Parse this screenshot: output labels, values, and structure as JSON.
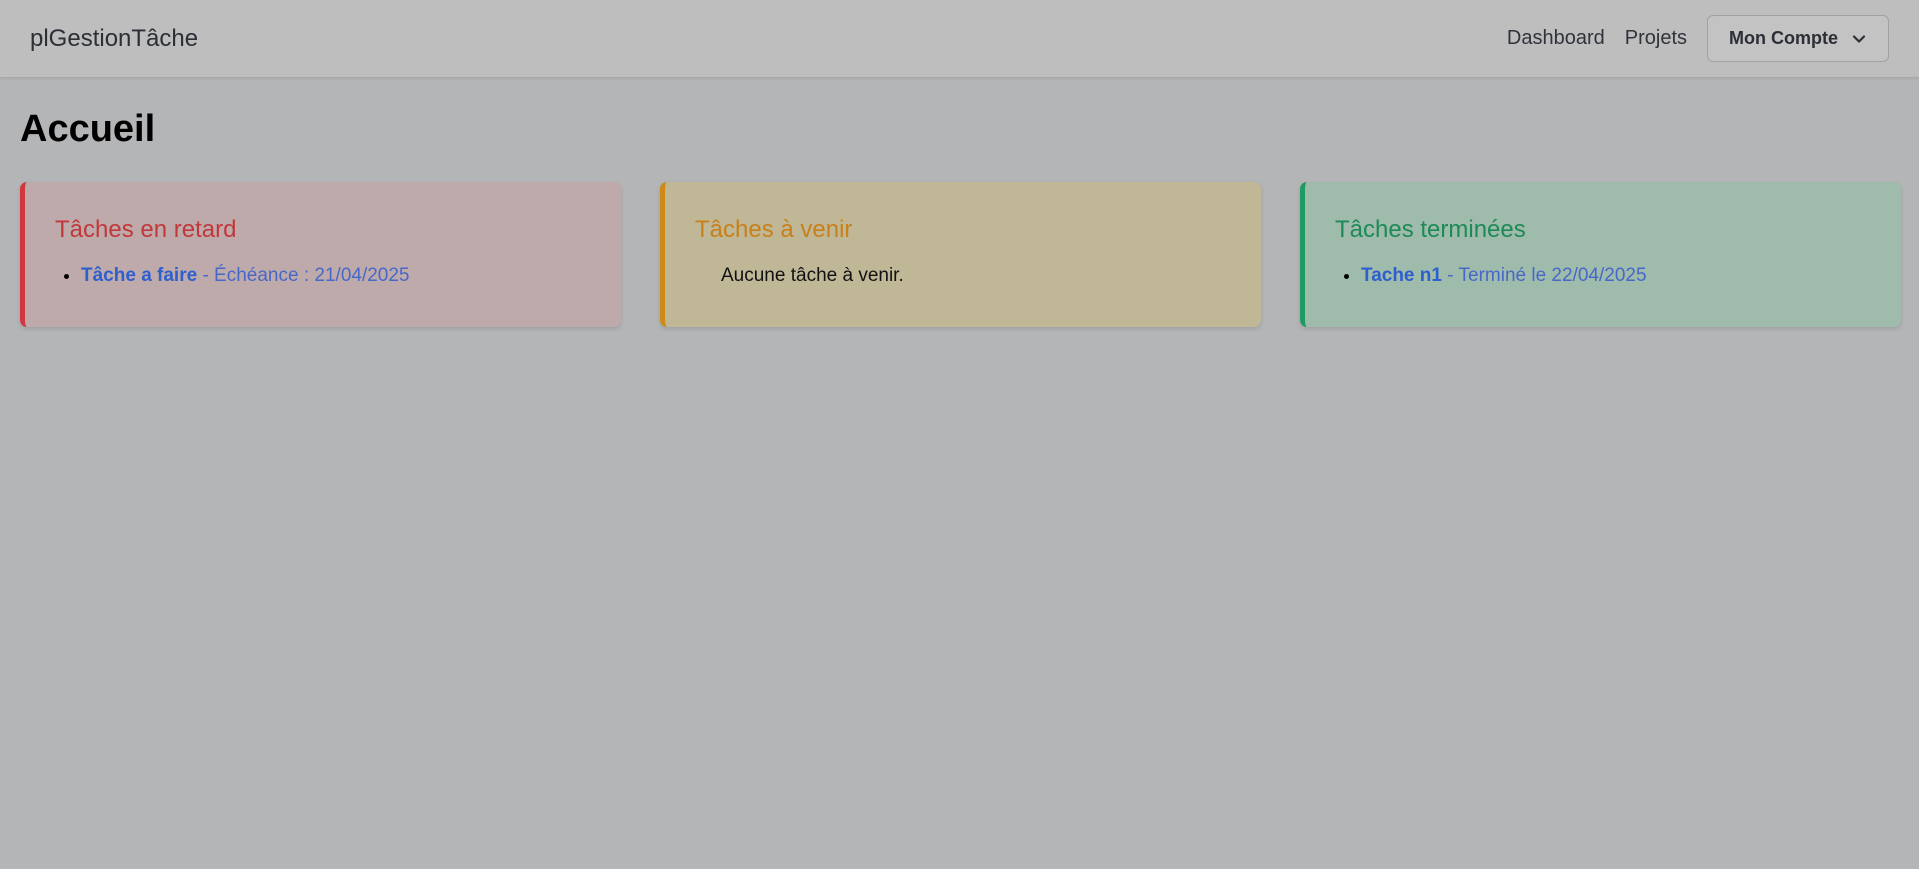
{
  "navbar": {
    "brand": "plGestionTâche",
    "links": [
      {
        "label": "Dashboard"
      },
      {
        "label": "Projets"
      }
    ],
    "account_label": "Mon Compte"
  },
  "page": {
    "title": "Accueil"
  },
  "cards": {
    "late": {
      "title": "Tâches en retard",
      "items": [
        {
          "name": "Tâche a faire",
          "detail": " - Échéance : 21/04/2025"
        }
      ],
      "accent": "#d1373e"
    },
    "upcoming": {
      "title": "Tâches à venir",
      "empty_text": "Aucune tâche à venir.",
      "accent": "#cd8a15"
    },
    "done": {
      "title": "Tâches terminées",
      "items": [
        {
          "name": "Tache n1",
          "detail": " - Terminé le 22/04/2025"
        }
      ],
      "accent": "#1f9a63"
    }
  }
}
